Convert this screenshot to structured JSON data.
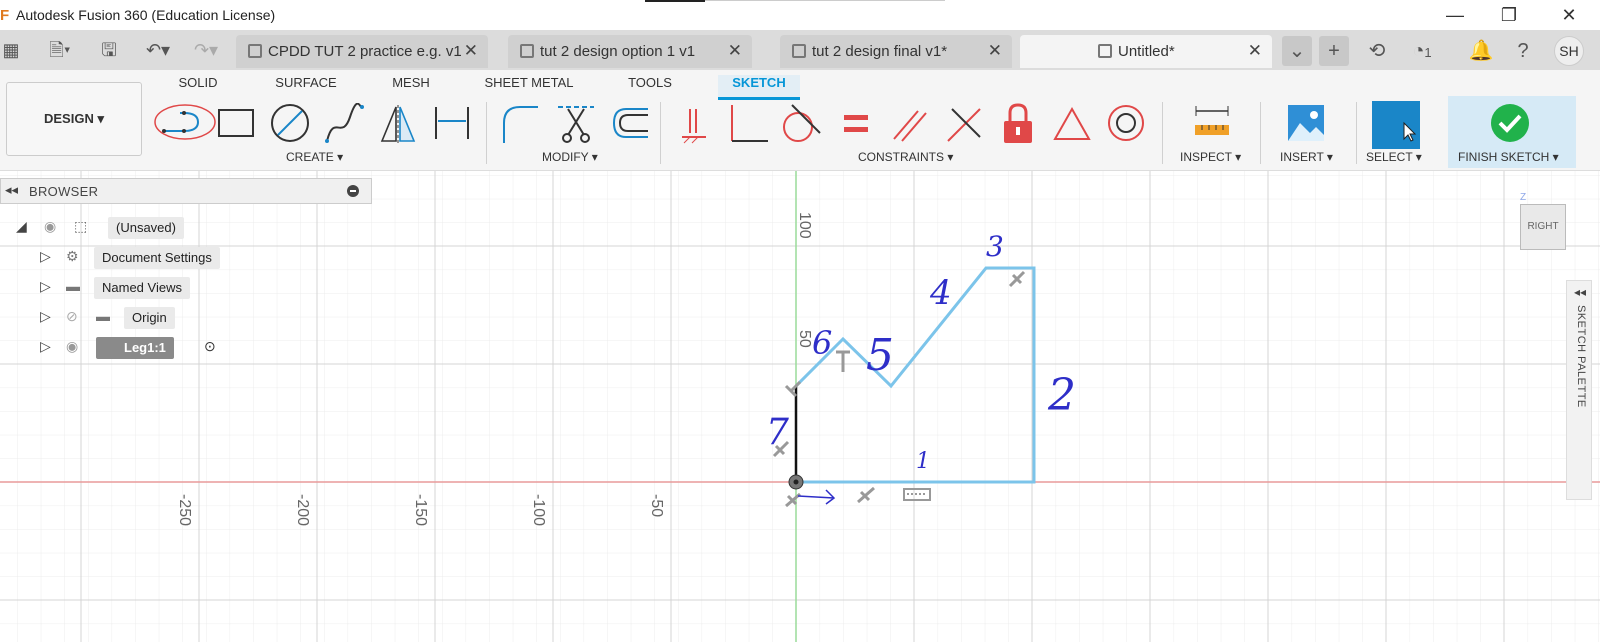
{
  "app": {
    "title": "Autodesk Fusion 360 (Education License)",
    "window_controls": [
      "—",
      "❐",
      "✕"
    ]
  },
  "tabs": [
    {
      "label": "CPDD TUT 2 practice e.g. v1",
      "active": false
    },
    {
      "label": "tut 2 design option 1 v1",
      "active": false
    },
    {
      "label": "tut 2 design final v1*",
      "active": false
    },
    {
      "label": "Untitled*",
      "active": true
    }
  ],
  "header": {
    "job_count": "1",
    "avatar": "SH"
  },
  "toolbar": {
    "workspace": "DESIGN",
    "ws_tabs": [
      "SOLID",
      "SURFACE",
      "MESH",
      "SHEET METAL",
      "TOOLS",
      "SKETCH"
    ],
    "active_ws_tab": "SKETCH",
    "groups": {
      "create": "CREATE",
      "modify": "MODIFY",
      "constraints": "CONSTRAINTS",
      "inspect": "INSPECT",
      "insert": "INSERT",
      "select": "SELECT",
      "finish": "FINISH SKETCH"
    },
    "colors": {
      "accent": "#0696d7",
      "sketch_line": "#7cc4ea",
      "constraint_red": "#e04848",
      "finish_green": "#21b24b",
      "annotation": "#2e2ec8"
    }
  },
  "browser": {
    "title": "BROWSER",
    "items": [
      {
        "label": "(Unsaved)"
      },
      {
        "label": "Document Settings"
      },
      {
        "label": "Named Views"
      },
      {
        "label": "Origin"
      },
      {
        "label": "Leg1:1"
      }
    ]
  },
  "canvas": {
    "axis_labels_x": [
      "-250",
      "-200",
      "-150",
      "-100",
      "-50"
    ],
    "axis_labels_y": [
      "100",
      "50"
    ],
    "annotations": [
      "1",
      "2",
      "3",
      "4",
      "5",
      "6",
      "7"
    ]
  },
  "viewcube": {
    "face": "RIGHT",
    "axis": "Z"
  },
  "sketch_palette": {
    "label": "SKETCH PALETTE"
  }
}
